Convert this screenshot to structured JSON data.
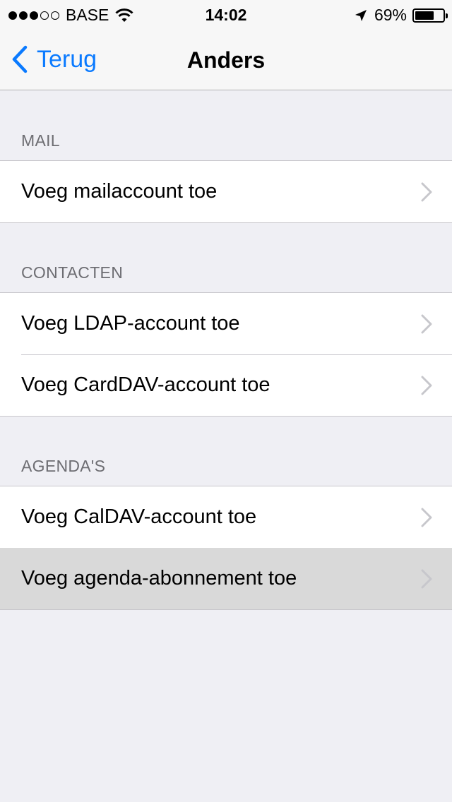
{
  "status_bar": {
    "signal_filled": 3,
    "signal_total": 5,
    "carrier": "BASE",
    "time": "14:02",
    "battery_pct": "69%",
    "battery_level": 0.69
  },
  "nav": {
    "back_label": "Terug",
    "title": "Anders"
  },
  "sections": [
    {
      "header": "MAIL",
      "items": [
        {
          "label": "Voeg mailaccount toe"
        }
      ]
    },
    {
      "header": "CONTACTEN",
      "items": [
        {
          "label": "Voeg LDAP-account toe"
        },
        {
          "label": "Voeg CardDAV-account toe"
        }
      ]
    },
    {
      "header": "AGENDA'S",
      "items": [
        {
          "label": "Voeg CalDAV-account toe"
        },
        {
          "label": "Voeg agenda-abonnement toe",
          "highlighted": true
        }
      ]
    }
  ],
  "colors": {
    "accent": "#0a7aff",
    "background": "#efeff4",
    "highlight": "#d9d9d9"
  }
}
